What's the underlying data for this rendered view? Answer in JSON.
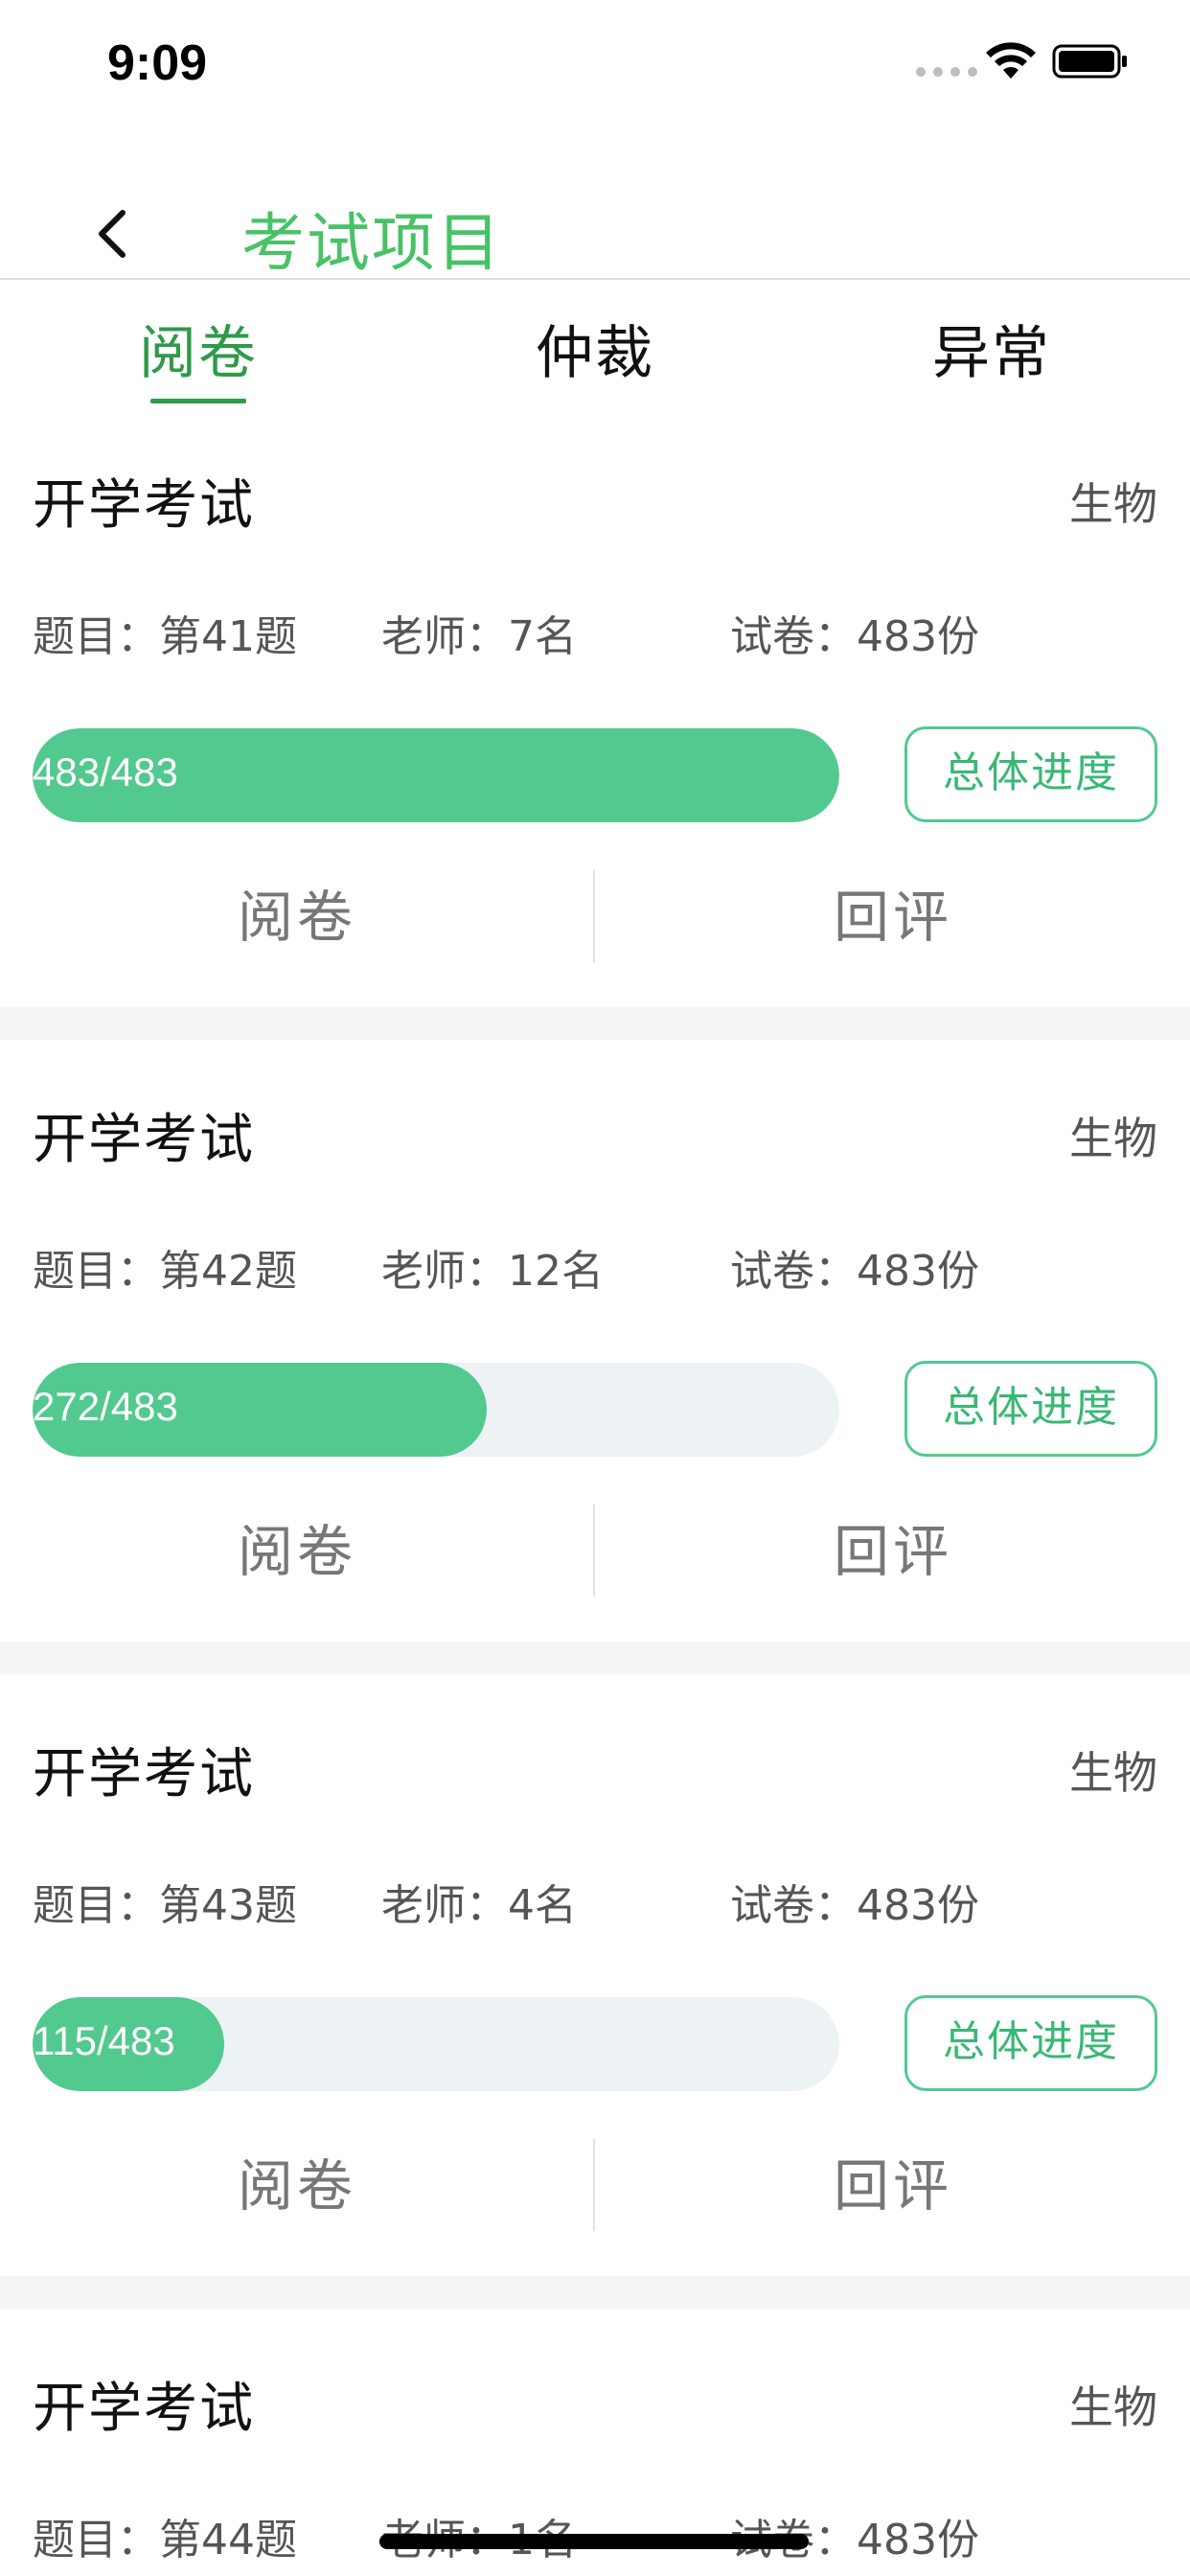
{
  "status_bar": {
    "time": "9:09"
  },
  "nav": {
    "title": "考试项目"
  },
  "tabs": [
    {
      "label": "阅卷",
      "active": true
    },
    {
      "label": "仲裁",
      "active": false
    },
    {
      "label": "异常",
      "active": false
    }
  ],
  "cards": [
    {
      "title": "开学考试",
      "subject": "生物",
      "question": "题目：第41题",
      "teachers": "老师：7名",
      "papers": "试卷：483份",
      "progress_text": "483/483",
      "progress_fraction": 1.0,
      "overall_label": "总体进度",
      "action_review": "阅卷",
      "action_rescore": "回评"
    },
    {
      "title": "开学考试",
      "subject": "生物",
      "question": "题目：第42题",
      "teachers": "老师：12名",
      "papers": "试卷：483份",
      "progress_text": "272/483",
      "progress_fraction": 0.5631,
      "overall_label": "总体进度",
      "action_review": "阅卷",
      "action_rescore": "回评"
    },
    {
      "title": "开学考试",
      "subject": "生物",
      "question": "题目：第43题",
      "teachers": "老师：4名",
      "papers": "试卷：483份",
      "progress_text": "115/483",
      "progress_fraction": 0.2381,
      "overall_label": "总体进度",
      "action_review": "阅卷",
      "action_rescore": "回评"
    },
    {
      "title": "开学考试",
      "subject": "生物",
      "question": "题目：第44题",
      "teachers": "老师：1名",
      "papers": "试卷：483份"
    }
  ],
  "colors": {
    "accent": "#48c266",
    "progress": "#52c98f",
    "tab_active": "#2f9a4a"
  }
}
